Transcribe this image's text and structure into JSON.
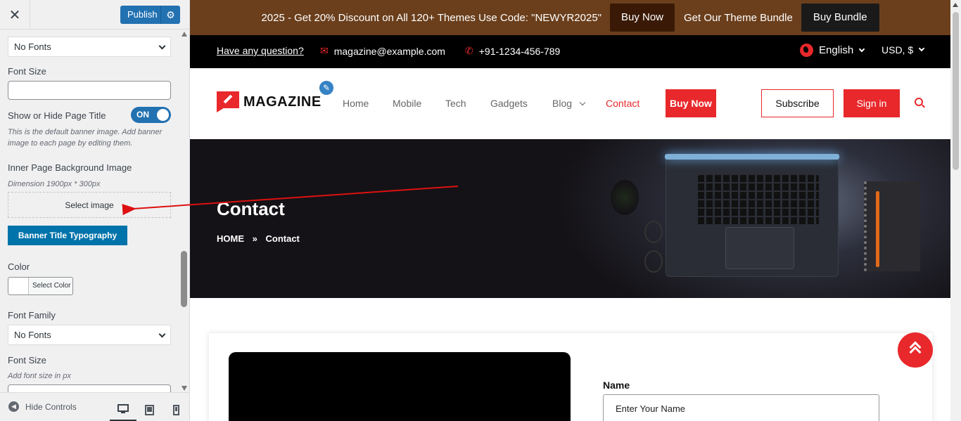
{
  "customizer": {
    "close_icon": "✕",
    "publish_label": "Publish",
    "sections": {
      "font_family_top_value": "No Fonts",
      "font_size_label": "Font Size",
      "show_hide_label": "Show or Hide Page Title",
      "toggle_label": "ON",
      "show_hide_desc": "This is the default banner image. Add banner image to each page by editing them.",
      "inner_bg_label": "Inner Page Background Image",
      "inner_bg_desc": "Dimension 1900px * 300px",
      "select_image_label": "Select image",
      "banner_typo_label": "Banner Title Typography",
      "color_label": "Color",
      "select_color_label": "Select Color",
      "font_family_label": "Font Family",
      "font_family_value": "No Fonts",
      "font_size_label_2": "Font Size",
      "font_size_desc": "Add font size in px"
    },
    "footer": {
      "hide_controls_label": "Hide Controls"
    }
  },
  "preview": {
    "promo": {
      "text": "2025 - Get 20% Discount on All 120+ Themes Use Code: \"NEWYR2025\"",
      "buy_now": "Buy Now",
      "bundle_text": "Get Our Theme Bundle",
      "buy_bundle": "Buy Bundle"
    },
    "topbar": {
      "question": "Have any question?",
      "email": "magazine@example.com",
      "phone": "+91-1234-456-789",
      "language": "English",
      "currency": "USD, $"
    },
    "nav": {
      "logo": "MAGAZINE",
      "items": [
        "Home",
        "Mobile",
        "Tech",
        "Gadgets",
        "Blog",
        "Contact"
      ],
      "buy_now": "Buy Now",
      "subscribe": "Subscribe",
      "sign_in": "Sign in"
    },
    "banner": {
      "title": "Contact",
      "crumb_home": "HOME",
      "crumb_sep": "»",
      "crumb_current": "Contact"
    },
    "form": {
      "name_label": "Name",
      "name_placeholder": "Enter Your Name"
    }
  },
  "colors": {
    "accent_red": "#e8282b",
    "wp_blue": "#2271b1",
    "promo_brown": "#6b3f1c"
  }
}
